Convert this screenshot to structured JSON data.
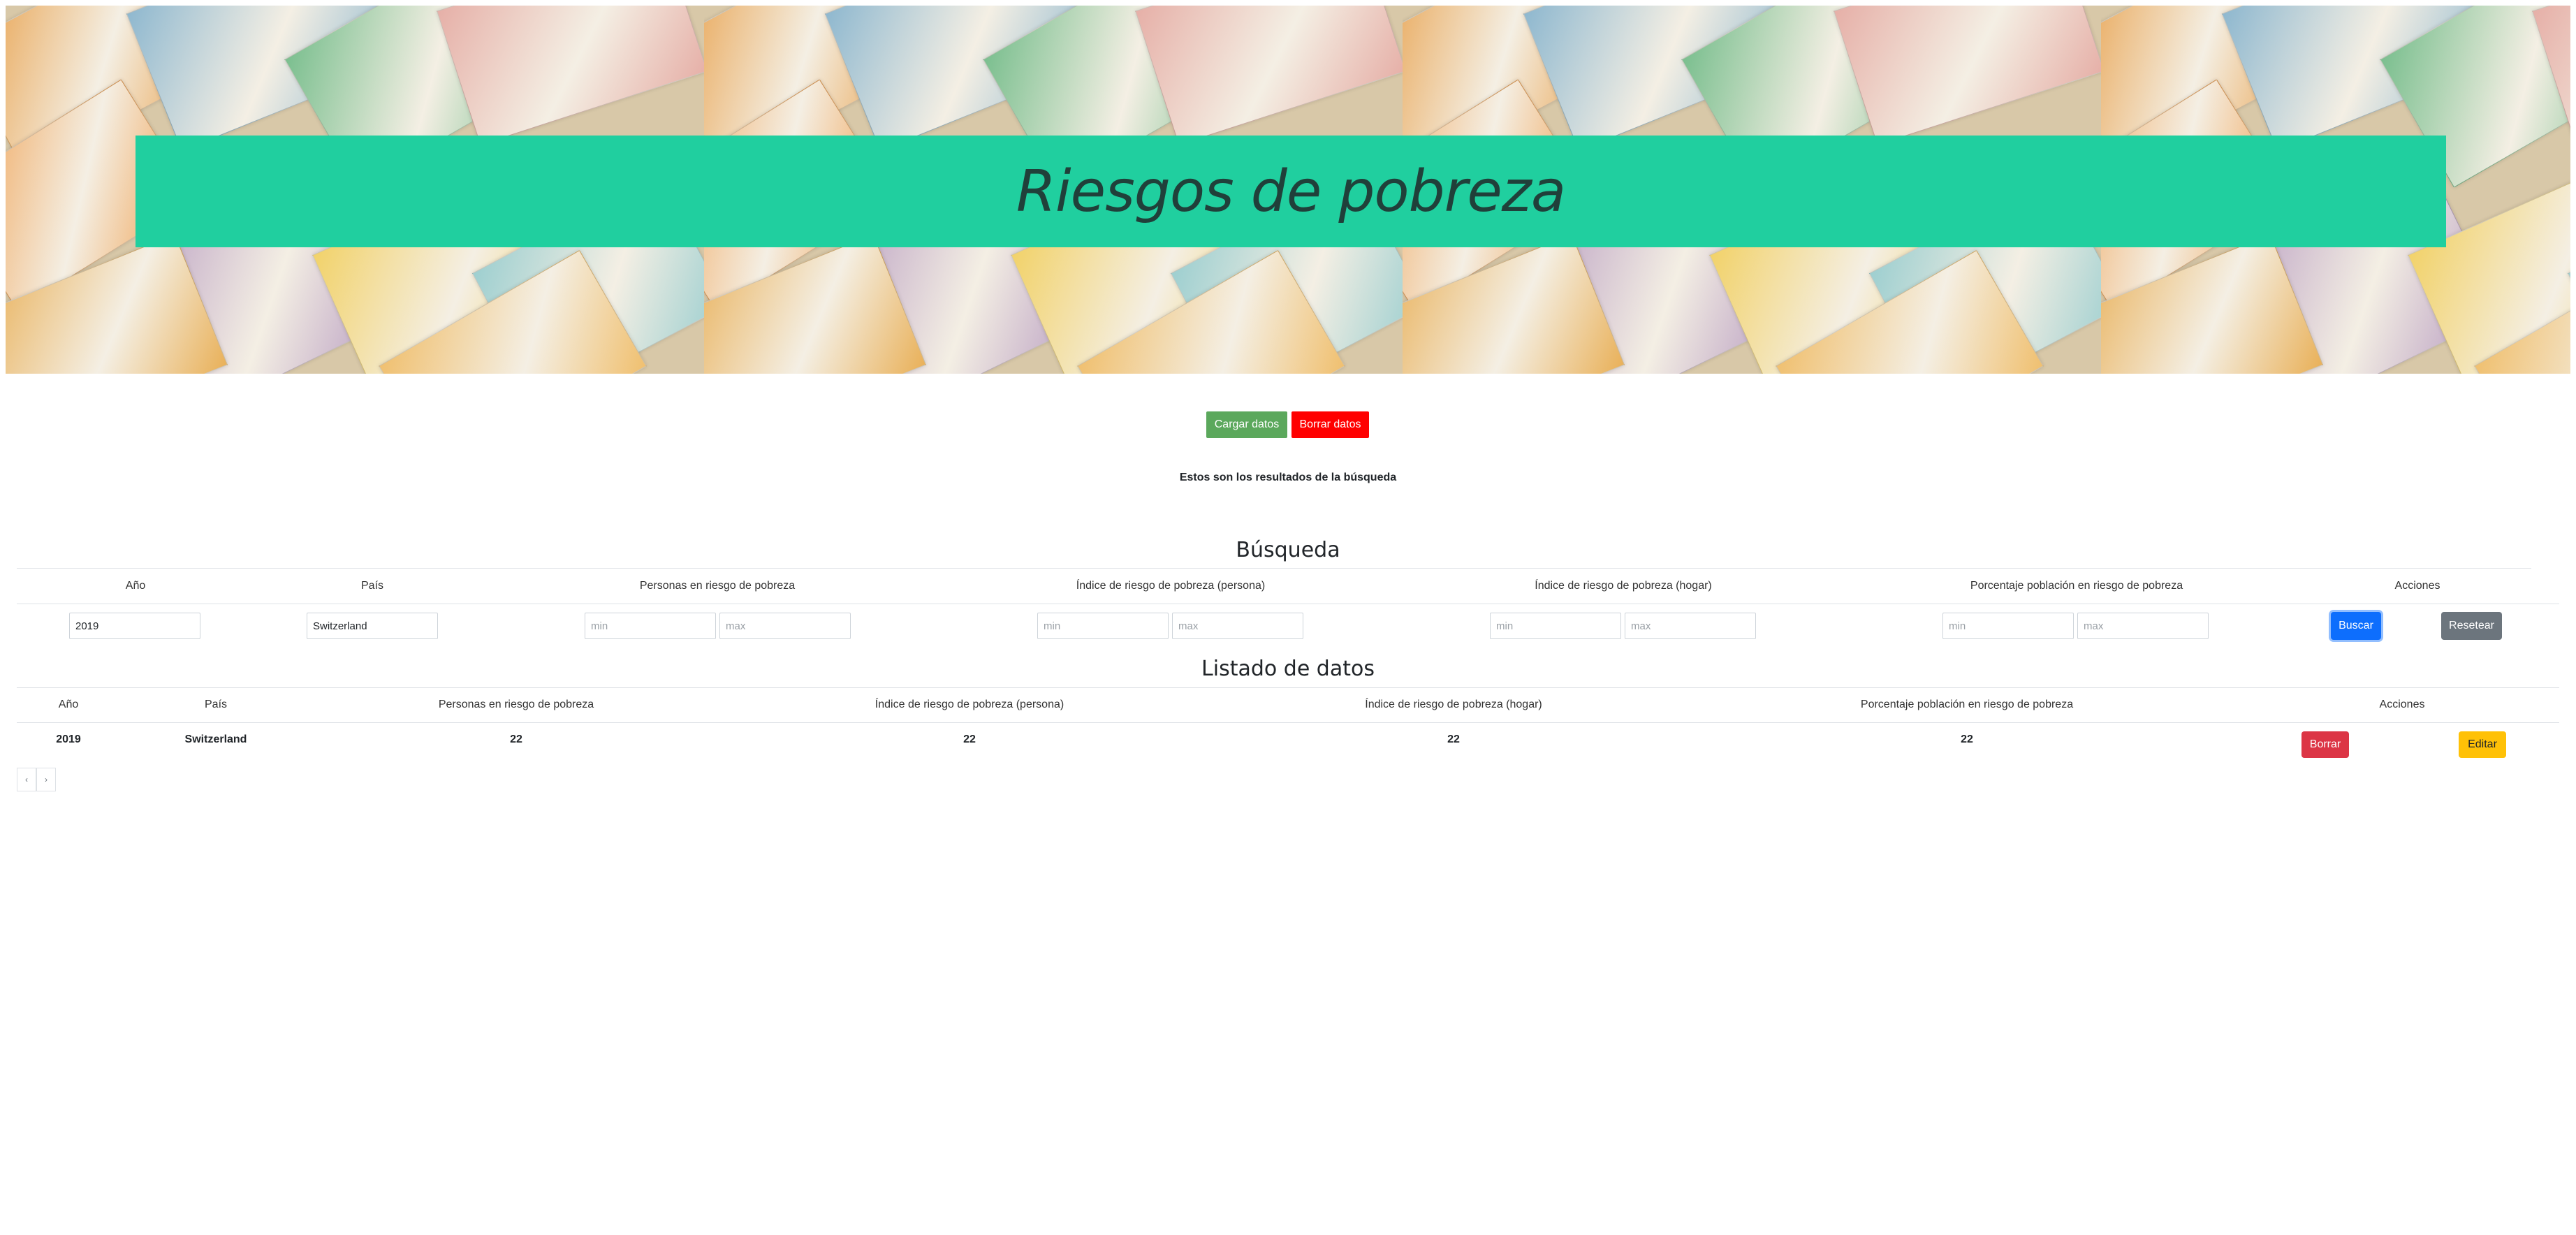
{
  "header": {
    "title": "Riesgos de pobreza"
  },
  "actions": {
    "load_label": "Cargar datos",
    "delete_label": "Borrar datos"
  },
  "status": {
    "message": "Estos son los resultados de la búsqueda"
  },
  "search": {
    "title": "Búsqueda",
    "columns": [
      "Año",
      "País",
      "Personas en riesgo de pobreza",
      "Índice de riesgo de pobreza (persona)",
      "Índice de riesgo de pobreza (hogar)",
      "Porcentaje población en riesgo de pobreza",
      "Acciones"
    ],
    "year_value": "2019",
    "country_value": "Switzerland",
    "min_placeholder": "min",
    "max_placeholder": "max",
    "search_label": "Buscar",
    "reset_label": "Resetear"
  },
  "list": {
    "title": "Listado de datos",
    "columns": [
      "Año",
      "País",
      "Personas en riesgo de pobreza",
      "Índice de riesgo de pobreza (persona)",
      "Índice de riesgo de pobreza (hogar)",
      "Porcentaje población en riesgo de pobreza",
      "Acciones"
    ],
    "rows": [
      {
        "year": "2019",
        "country": "Switzerland",
        "people": "22",
        "idx_person": "22",
        "idx_home": "22",
        "percent": "22",
        "delete_label": "Borrar",
        "edit_label": "Editar"
      }
    ]
  },
  "pagination": {
    "prev": "‹",
    "next": "›"
  },
  "colors": {
    "banner": "#20cf9f",
    "success": "#5ba85c",
    "danger": "#ff0000",
    "primary": "#0d6efd",
    "secondary": "#6c757d",
    "warning": "#ffc107"
  }
}
